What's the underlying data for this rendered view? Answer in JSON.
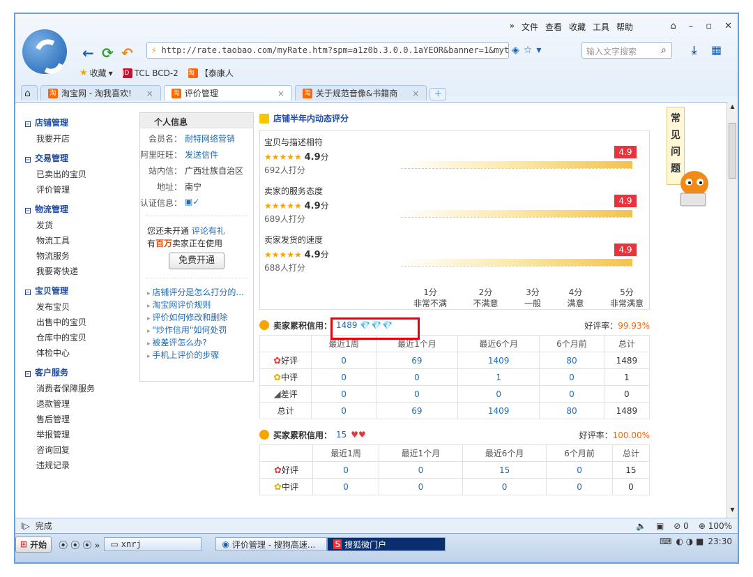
{
  "browser": {
    "menus": [
      "»",
      "文件",
      "查看",
      "收藏",
      "工具",
      "帮助"
    ],
    "url": "http://rate.taobao.com/myRate.htm?spm=a1z0b.3.0.0.1aYEOR&banner=1&mytm",
    "search_placeholder": "输入文字搜索",
    "bookmarks": [
      "收藏",
      "TCL BCD-2",
      "【泰康人"
    ],
    "tabs": [
      {
        "label": "淘宝网 - 淘我喜欢!",
        "active": false
      },
      {
        "label": "评价管理",
        "active": true
      },
      {
        "label": "关于规范音像&书籍商",
        "active": false
      }
    ],
    "status_text": "完成",
    "zoom": "100%",
    "status_count": "0"
  },
  "sidebar": {
    "sections": [
      {
        "title": "店铺管理",
        "items": [
          "我要开店"
        ]
      },
      {
        "title": "交易管理",
        "items": [
          "已卖出的宝贝",
          "评价管理"
        ]
      },
      {
        "title": "物流管理",
        "items": [
          "发货",
          "物流工具",
          "物流服务",
          "我要寄快递"
        ]
      },
      {
        "title": "宝贝管理",
        "items": [
          "发布宝贝",
          "出售中的宝贝",
          "仓库中的宝贝",
          "体检中心"
        ]
      },
      {
        "title": "客户服务",
        "items": [
          "消费者保障服务",
          "退款管理",
          "售后管理",
          "举报管理",
          "咨询回复",
          "违规记录"
        ]
      }
    ]
  },
  "info": {
    "title": "个人信息",
    "member_label": "会员名：",
    "member_value": "耐特网络营销",
    "wangwang_label": "阿里旺旺：",
    "wangwang_value": "发送信件",
    "station_label": "站内信：",
    "station_value": "广西壮族自治区",
    "address_label": "地址：",
    "address_value": "南宁",
    "cert_label": "认证信息：",
    "open_text_1": "您还未开通",
    "open_link": "评论有礼",
    "open_text_2": "有",
    "open_highlight": "百万",
    "open_text_3": "卖家正在使用",
    "free_button": "免费开通",
    "links": [
      "店铺评分是怎么打分的...",
      "淘宝网评价规则",
      "评价如何修改和删除",
      "\"炒作信用\"如何处罚",
      "被差评怎么办?",
      "手机上评价的步骤"
    ]
  },
  "dynamic": {
    "title": "店铺半年内动态评分",
    "items": [
      {
        "name": "宝贝与描述相符",
        "stars": "★★★★★",
        "score": "4.9",
        "unit": "分",
        "count": "692人打分",
        "flag": "4.9",
        "value": 4.9
      },
      {
        "name": "卖家的服务态度",
        "stars": "★★★★★",
        "score": "4.9",
        "unit": "分",
        "count": "689人打分",
        "flag": "4.9",
        "value": 4.9
      },
      {
        "name": "卖家发货的速度",
        "stars": "★★★★★",
        "score": "4.9",
        "unit": "分",
        "count": "688人打分",
        "flag": "4.9",
        "value": 4.9
      }
    ],
    "scale": [
      {
        "score": "1分",
        "desc": "非常不满"
      },
      {
        "score": "2分",
        "desc": "不满意"
      },
      {
        "score": "3分",
        "desc": "一般"
      },
      {
        "score": "4分",
        "desc": "满意"
      },
      {
        "score": "5分",
        "desc": "非常满意"
      }
    ]
  },
  "seller_credit": {
    "label": "卖家累积信用：",
    "score": "1489",
    "icons": "💎💎💎",
    "rate_label": "好评率：",
    "rate_value": "99.93%",
    "headers": [
      "",
      "最近1周",
      "最近1个月",
      "最近6个月",
      "6个月前",
      "总计"
    ],
    "rows": [
      {
        "label": "好评",
        "values": [
          "0",
          "69",
          "1409",
          "80",
          "1489"
        ]
      },
      {
        "label": "中评",
        "values": [
          "0",
          "0",
          "1",
          "0",
          "1"
        ]
      },
      {
        "label": "差评",
        "values": [
          "0",
          "0",
          "0",
          "0",
          "0"
        ]
      },
      {
        "label": "总计",
        "values": [
          "0",
          "69",
          "1409",
          "80",
          "1489"
        ]
      }
    ]
  },
  "buyer_credit": {
    "label": "买家累积信用：",
    "score": "15",
    "icons": "♥♥",
    "rate_label": "好评率：",
    "rate_value": "100.00%",
    "headers": [
      "",
      "最近1周",
      "最近1个月",
      "最近6个月",
      "6个月前",
      "总计"
    ],
    "rows": [
      {
        "label": "好评",
        "values": [
          "0",
          "0",
          "15",
          "0",
          "15"
        ]
      },
      {
        "label": "中评",
        "values": [
          "0",
          "0",
          "0",
          "0",
          "0"
        ]
      }
    ]
  },
  "faq": "常见问题",
  "taskbar": {
    "start": "开始",
    "items": [
      "xnrj",
      "评价管理 - 搜狗高速...",
      "搜狐微门户"
    ],
    "time": "23:30"
  }
}
